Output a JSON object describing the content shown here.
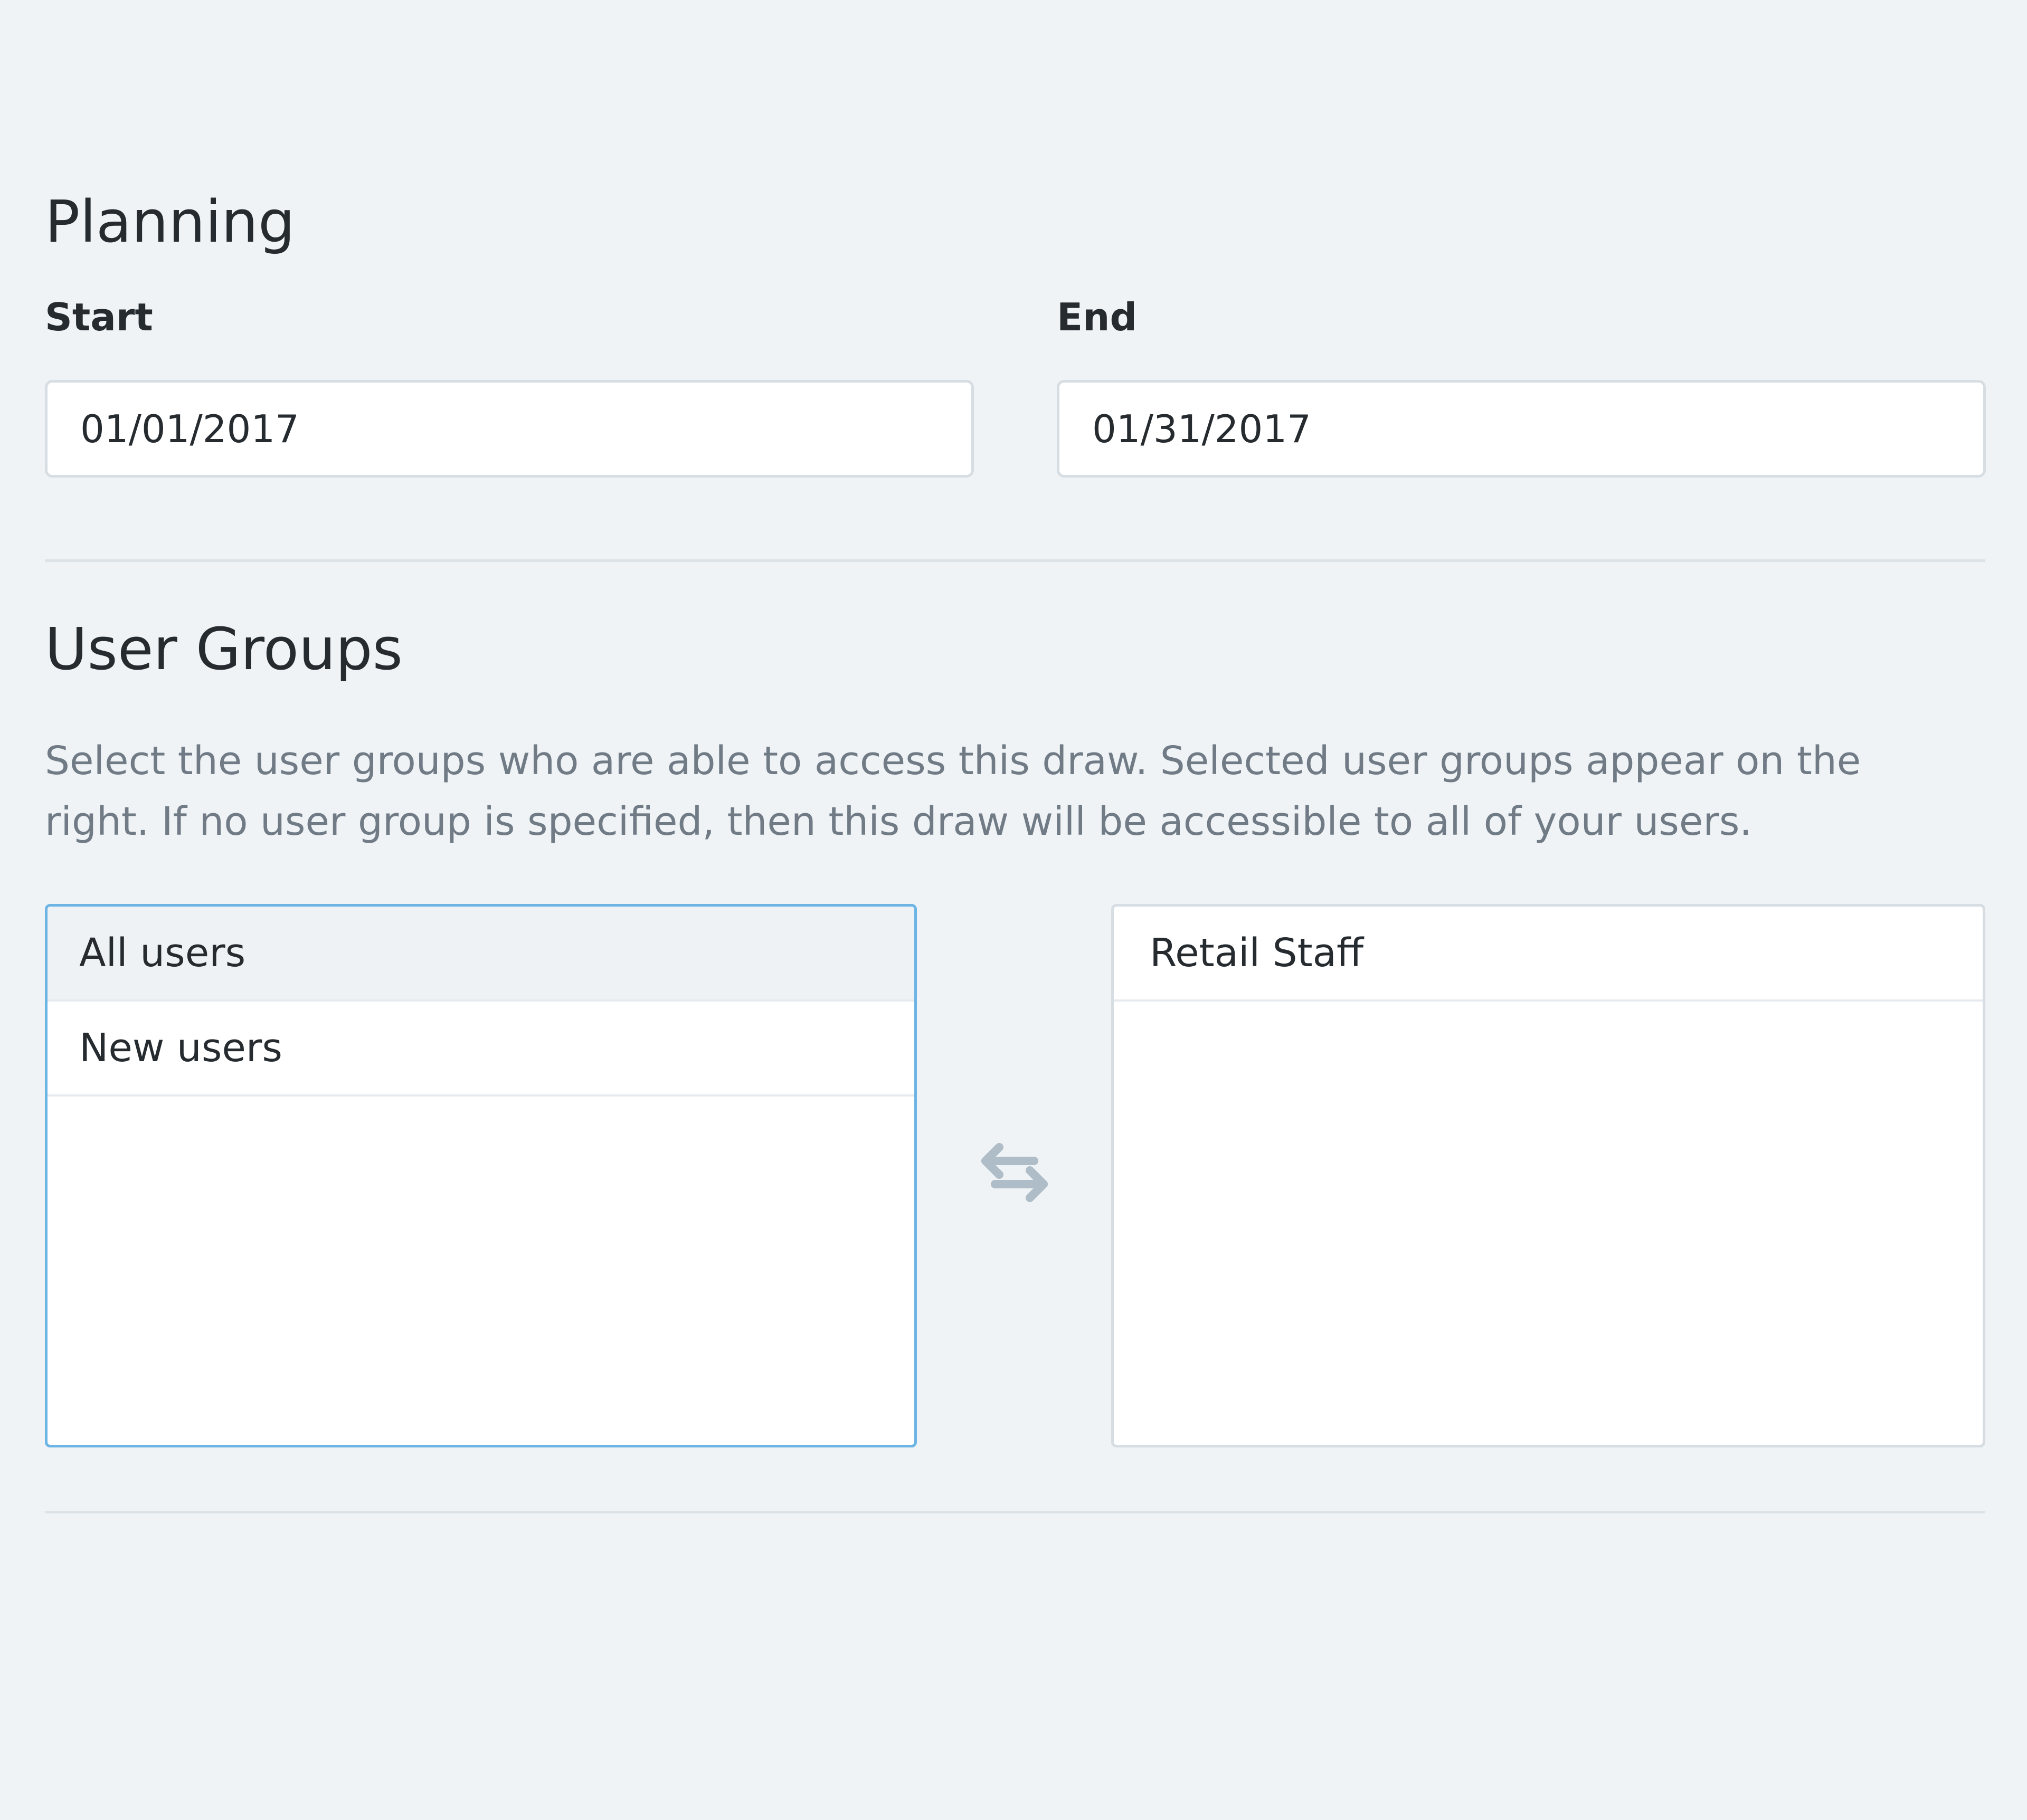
{
  "planning": {
    "title": "Planning",
    "start": {
      "label": "Start",
      "value": "01/01/2017"
    },
    "end": {
      "label": "End",
      "value": "01/31/2017"
    }
  },
  "user_groups": {
    "title": "User Groups",
    "description": "Select the user groups who are able to access this draw. Selected user groups appear on the right. If no user group is specified, then this draw will be accessible to all of your users.",
    "available": [
      {
        "label": "All users",
        "highlighted": true
      },
      {
        "label": "New users",
        "highlighted": false
      }
    ],
    "selected": [
      {
        "label": "Retail Staff"
      }
    ],
    "swap_icon": "swap-arrows-icon"
  },
  "colors": {
    "background": "#eff3f6",
    "focus_border": "#6cb4e4",
    "muted_text": "#707b86",
    "icon": "#aebdc7"
  }
}
